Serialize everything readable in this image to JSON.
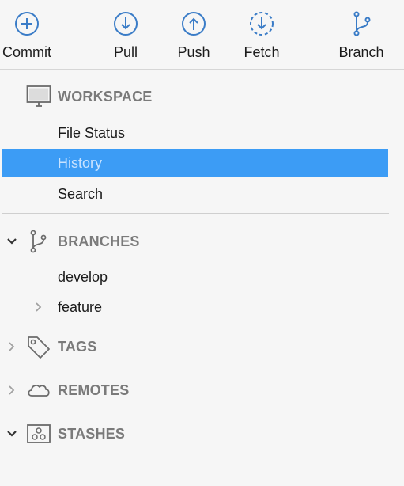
{
  "toolbar": {
    "commit": {
      "label": "Commit",
      "icon": "plus-circle-icon"
    },
    "pull": {
      "label": "Pull",
      "icon": "arrow-down-circle-icon"
    },
    "push": {
      "label": "Push",
      "icon": "arrow-up-circle-icon"
    },
    "fetch": {
      "label": "Fetch",
      "icon": "arrow-down-dashed-circle-icon"
    },
    "branch": {
      "label": "Branch",
      "icon": "branch-icon"
    }
  },
  "sidebar": {
    "workspace": {
      "title": "WORKSPACE",
      "icon": "monitor-icon",
      "items": [
        {
          "label": "File Status",
          "selected": false
        },
        {
          "label": "History",
          "selected": true
        },
        {
          "label": "Search",
          "selected": false
        }
      ]
    },
    "branches": {
      "title": "BRANCHES",
      "icon": "branch-icon",
      "expanded": true,
      "items": [
        {
          "label": "develop",
          "expandable": false
        },
        {
          "label": "feature",
          "expandable": true
        }
      ]
    },
    "tags": {
      "title": "TAGS",
      "icon": "tag-icon",
      "expanded": false
    },
    "remotes": {
      "title": "REMOTES",
      "icon": "cloud-icon",
      "expanded": false
    },
    "stashes": {
      "title": "STASHES",
      "icon": "stash-box-icon",
      "expanded": true
    }
  },
  "colors": {
    "accent": "#3c9cf5",
    "toolbar_icon": "#3a7cc7",
    "section_title": "#7a7a7a",
    "background": "#f6f6f6"
  }
}
